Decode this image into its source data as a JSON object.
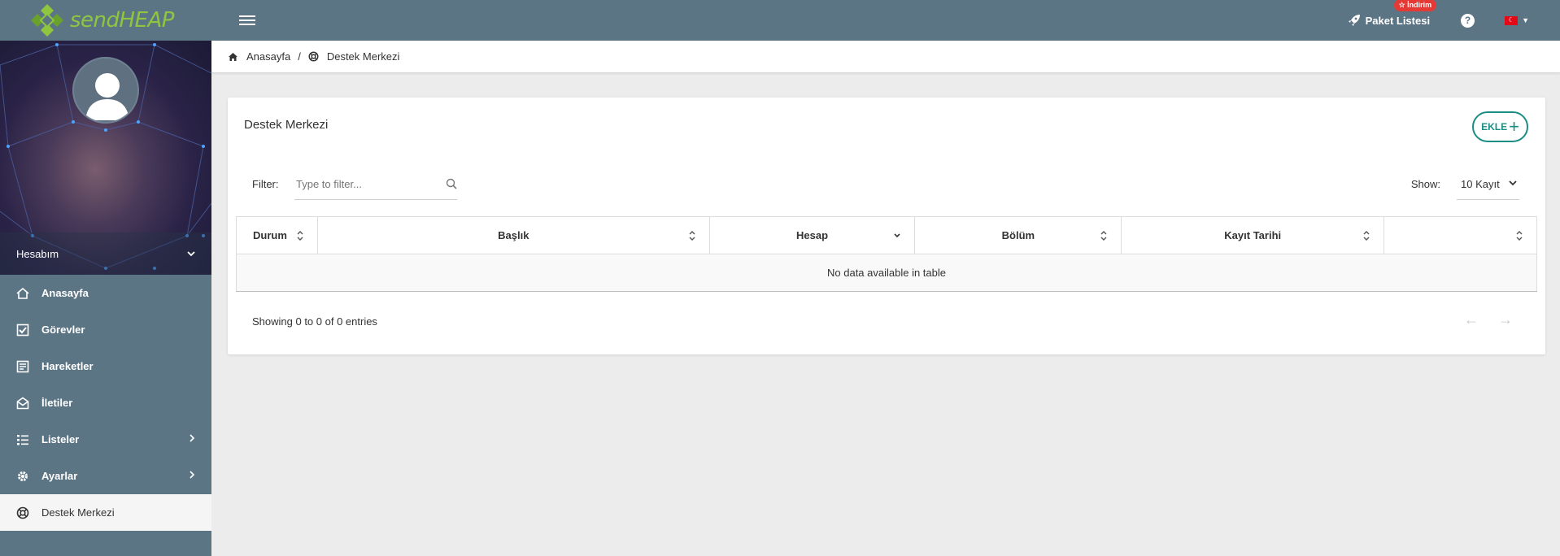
{
  "brand": {
    "logo_text": "sendHEAP",
    "accent": "#8ec63f"
  },
  "topbar": {
    "package_link": "Paket Listesi",
    "discount_badge": "☆ İndirim",
    "help": "?",
    "language_flag": "TR"
  },
  "sidebar": {
    "account_label": "Hesabım",
    "items": [
      {
        "label": "Anasayfa",
        "icon": "home-icon"
      },
      {
        "label": "Görevler",
        "icon": "checkbox-icon"
      },
      {
        "label": "Hareketler",
        "icon": "list-box-icon"
      },
      {
        "label": "İletiler",
        "icon": "envelope-icon"
      },
      {
        "label": "Listeler",
        "icon": "list-icon",
        "has_submenu": true
      },
      {
        "label": "Ayarlar",
        "icon": "gear-icon",
        "has_submenu": true
      },
      {
        "label": "Destek Merkezi",
        "icon": "lifebuoy-icon",
        "active": true
      }
    ]
  },
  "breadcrumb": {
    "home": "Anasayfa",
    "separator": "/",
    "current": "Destek Merkezi"
  },
  "card": {
    "title": "Destek Merkezi",
    "add_button": "EKLE",
    "filter_label": "Filter:",
    "filter_placeholder": "Type to filter...",
    "show_label": "Show:",
    "show_value": "10 Kayıt"
  },
  "table": {
    "columns": [
      "Durum",
      "Başlık",
      "Hesap",
      "Bölüm",
      "Kayıt Tarihi",
      ""
    ],
    "empty_message": "No data available in table",
    "info": "Showing 0 to 0 of 0 entries",
    "prev": "←",
    "next": "→"
  },
  "colors": {
    "nav": "#5c7585",
    "primary": "#1b8e84",
    "badge": "#e53935"
  }
}
